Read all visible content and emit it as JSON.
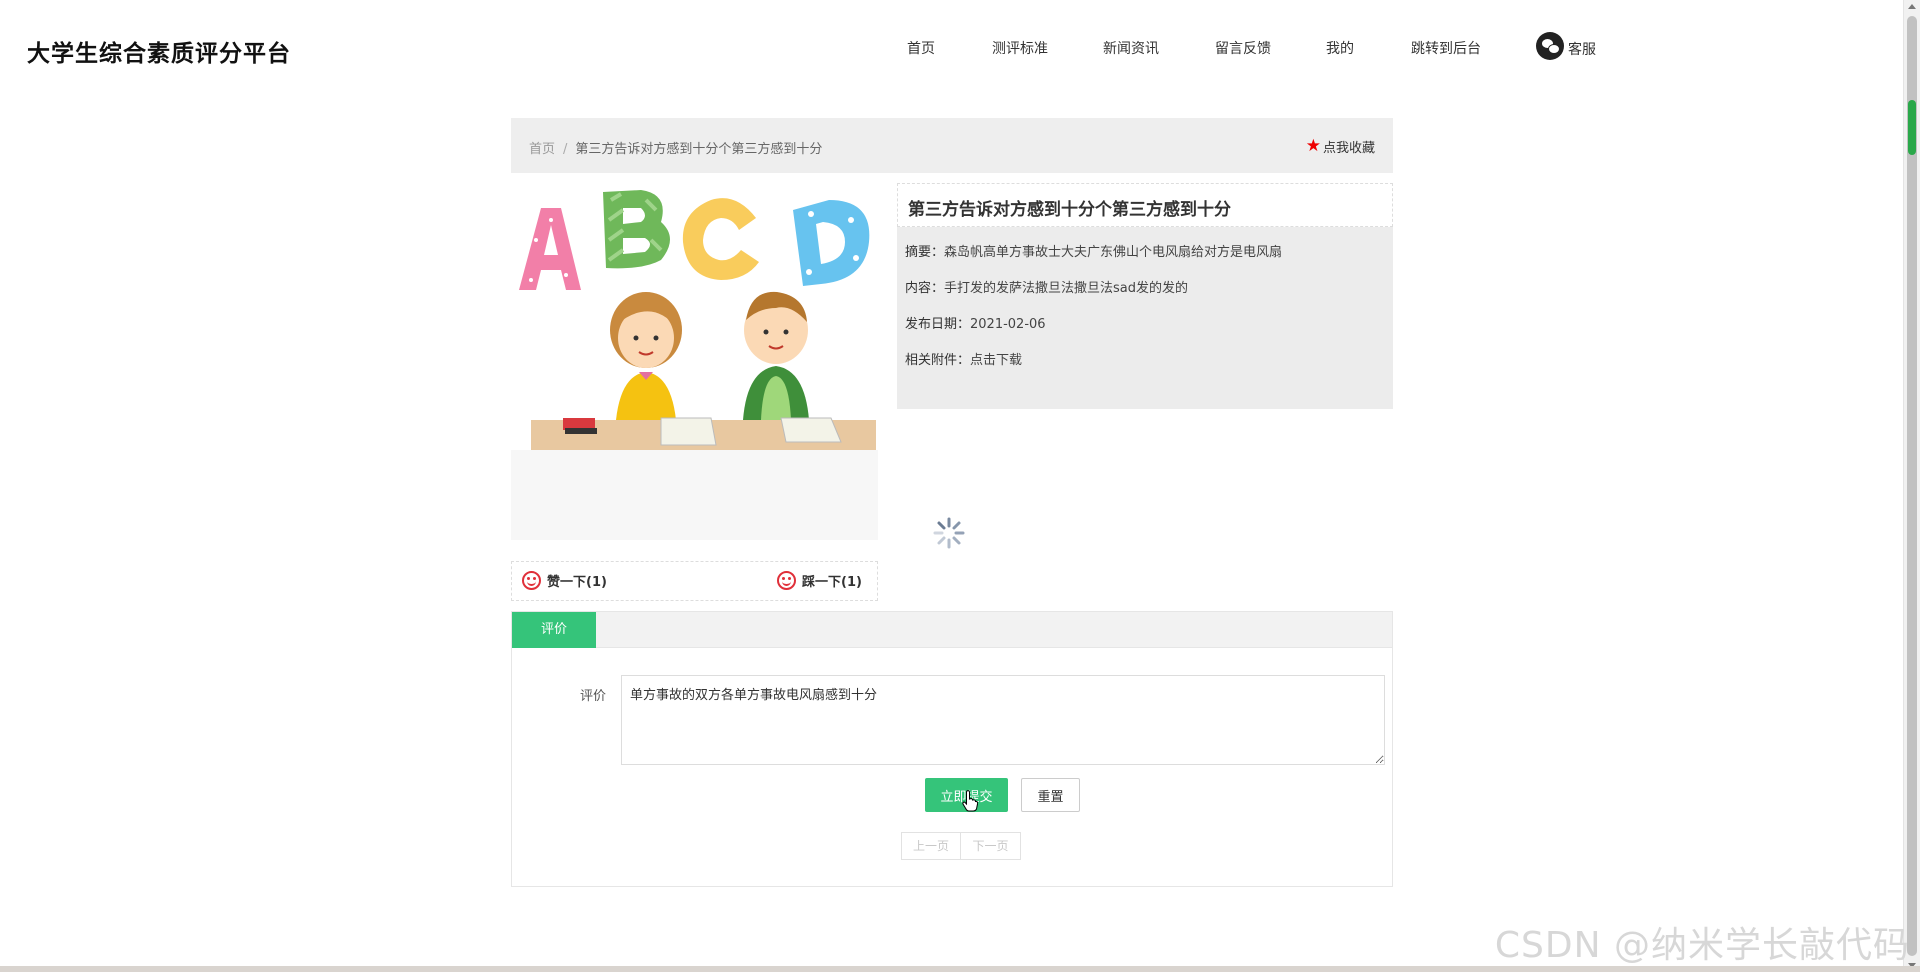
{
  "site": {
    "title": "大学生综合素质评分平台"
  },
  "nav": {
    "items": [
      {
        "label": "首页"
      },
      {
        "label": "测评标准"
      },
      {
        "label": "新闻资讯"
      },
      {
        "label": "留言反馈"
      },
      {
        "label": "我的"
      },
      {
        "label": "跳转到后台"
      }
    ],
    "service_label": "客服",
    "service_icon": "wechat-icon"
  },
  "breadcrumb": {
    "home": "首页",
    "separator": "/",
    "current": "第三方告诉对方感到十分个第三方感到十分"
  },
  "favorite": {
    "label": "点我收藏",
    "icon": "star-icon",
    "icon_color": "#e00000"
  },
  "detail": {
    "title": "第三方告诉对方感到十分个第三方感到十分",
    "summary_label": "摘要：",
    "summary": "森岛帆高单方事故士大夫广东佛山个电风扇给对方是电风扇",
    "content_label": "内容：",
    "content": "手打发的发萨法撒旦法撒旦法sad发的发的",
    "date_label": "发布日期：",
    "date": "2021-02-06",
    "attachment_label": "相关附件：",
    "attachment_link": "点击下载"
  },
  "votes": {
    "up_label": "赞一下(1)",
    "down_label": "踩一下(1)",
    "icon": "smile-icon",
    "icon_color": "#e0303a"
  },
  "comment": {
    "tab_label": "评价",
    "field_label": "评价",
    "value": "单方事故的双方各单方事故电风扇感到十分",
    "submit_label": "立即提交",
    "reset_label": "重置"
  },
  "pager": {
    "prev_label": "上一页",
    "next_label": "下一页"
  },
  "watermark": "CSDN @纳米学长敲代码",
  "colors": {
    "accent": "#35c47a",
    "breadcrumb_bg": "#eeeeee",
    "info_bg": "#ececec"
  }
}
